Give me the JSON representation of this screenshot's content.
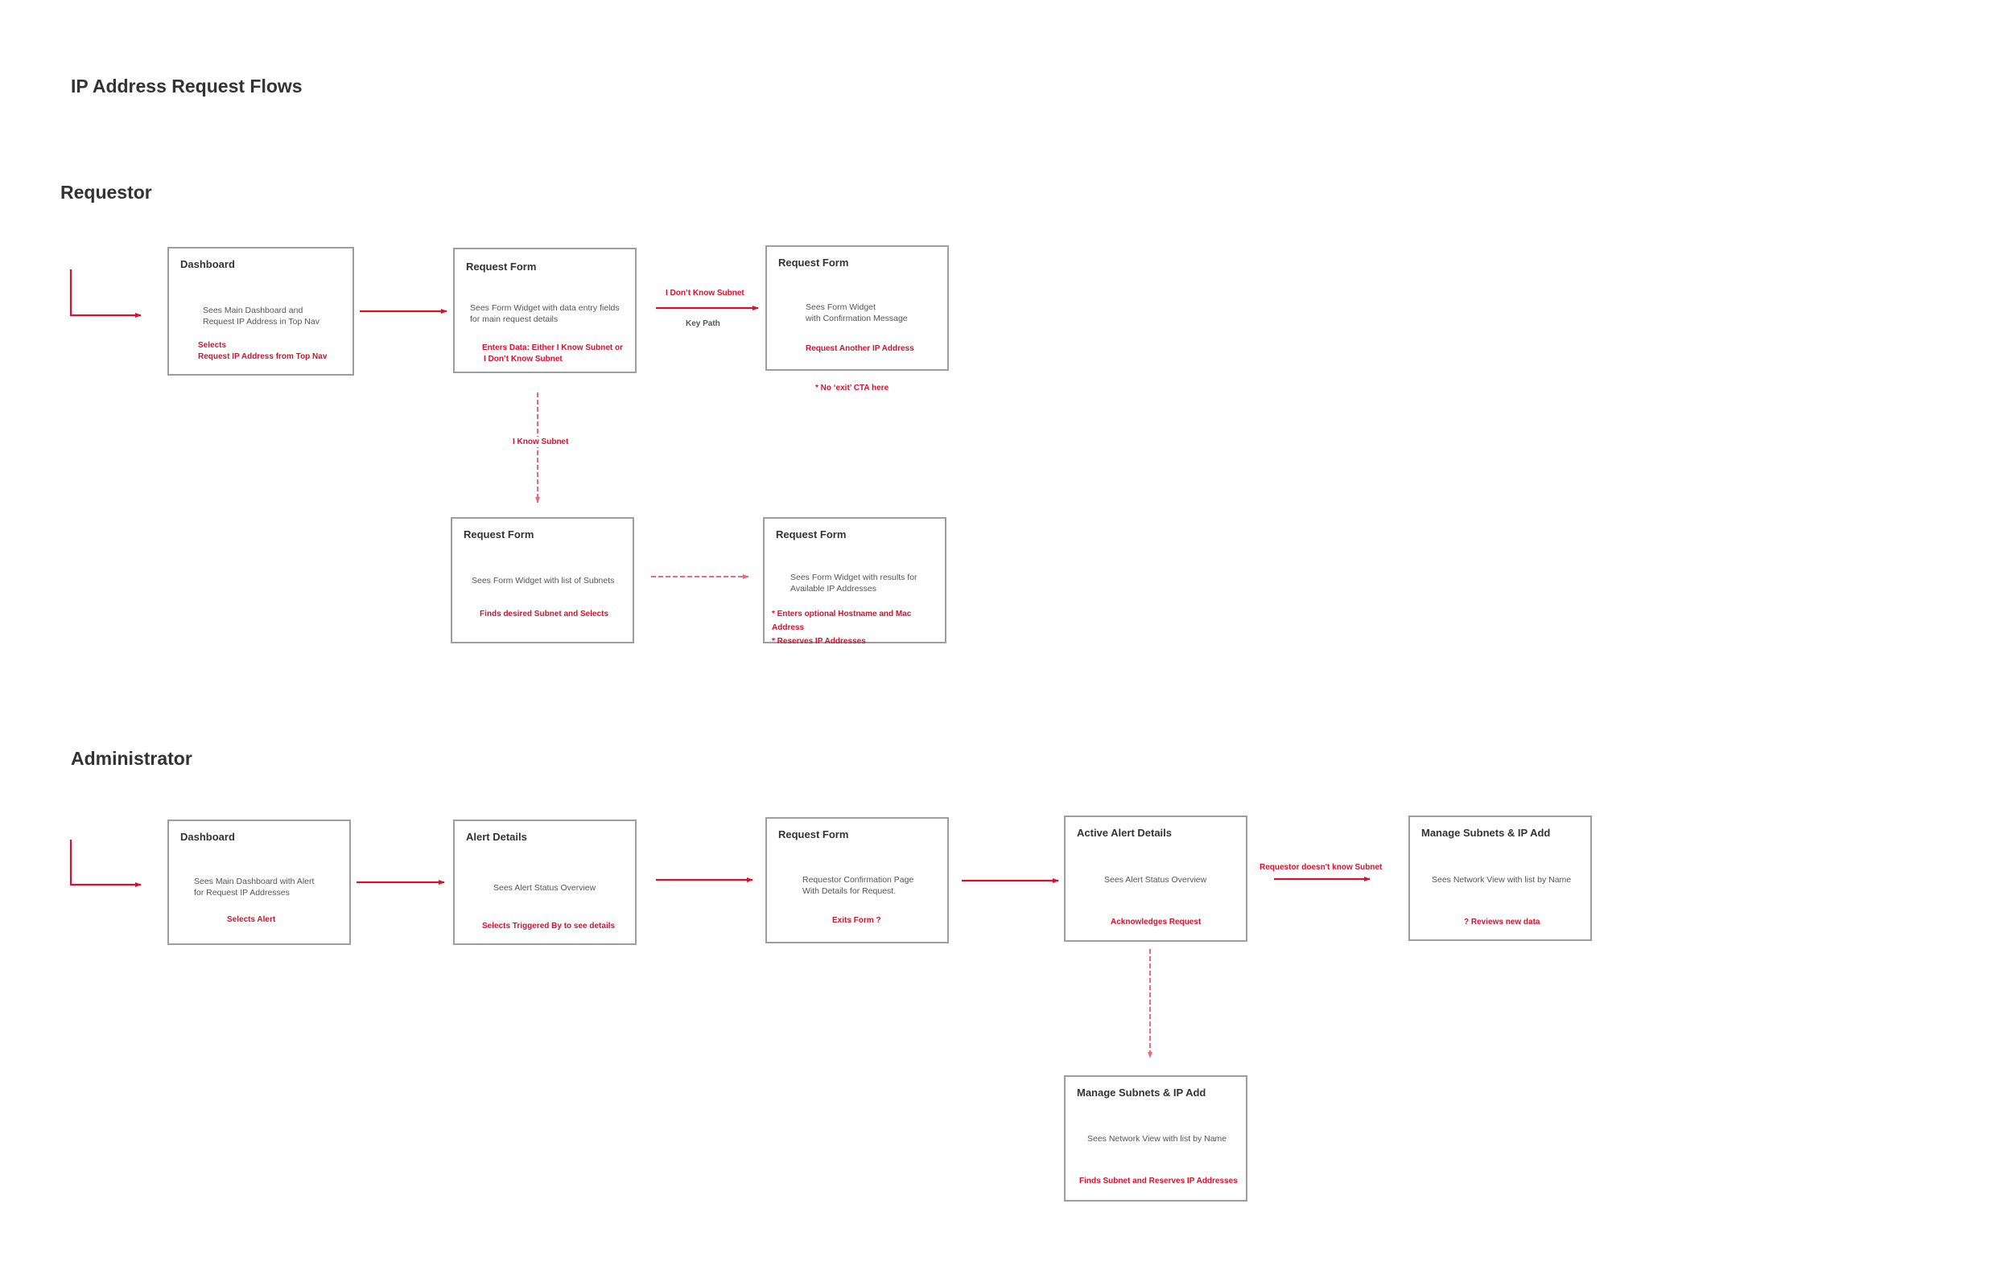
{
  "title": "IP Address Request Flows",
  "colors": {
    "accent": "#d6112f",
    "box_border": "#9e9e9e",
    "heading": "#333333",
    "body_text": "#555555"
  },
  "requestor": {
    "heading": "Requestor",
    "boxes": [
      {
        "title": "Dashboard",
        "description": "Sees Main Dashboard and\nRequest IP Address in Top Nav",
        "action": "Selects\nRequest IP Address from Top Nav"
      },
      {
        "title": "Request Form",
        "description": "Sees Form Widget with data entry fields\nfor main request details",
        "action": "Enters Data: Either I Know Subnet or\nI Don’t Know Subnet"
      },
      {
        "title": "Request Form",
        "description": "Sees Form Widget\nwith Confirmation Message",
        "action": "Request Another IP Address"
      },
      {
        "title": "Request Form",
        "description": "Sees Form Widget with list of Subnets",
        "action": "Finds desired Subnet and Selects"
      },
      {
        "title": "Request Form",
        "description": "Sees Form Widget with results for\nAvailable IP Addresses",
        "action": "* Enters optional Hostname and Mac Address\n* Reserves IP Addresses"
      }
    ],
    "connectors": {
      "dont_know_label": "I Don’t Know Subnet",
      "key_path_label": "Key Path",
      "know_label": "I Know Subnet",
      "note": "* No ‘exit’ CTA here"
    }
  },
  "administrator": {
    "heading": "Administrator",
    "boxes": [
      {
        "title": "Dashboard",
        "description": "Sees Main Dashboard with Alert\nfor Request IP Addresses",
        "action": "Selects Alert"
      },
      {
        "title": "Alert Details",
        "description": "Sees Alert Status Overview",
        "action": "Selects Triggered By to see details"
      },
      {
        "title": "Request Form",
        "description": "Requestor Confirmation Page\nWith Details for Request.",
        "action": "Exits Form ?"
      },
      {
        "title": "Active Alert Details",
        "description": "Sees Alert Status Overview",
        "action": "Acknowledges Request"
      },
      {
        "title": "Manage Subnets & IP Add",
        "description": "Sees Network View with list by Name",
        "action": "? Reviews new data"
      },
      {
        "title": "Manage Subnets & IP Add",
        "description": "Sees Network View with list by Name",
        "action": "Finds Subnet and Reserves IP Addresses"
      }
    ],
    "connectors": {
      "doesnt_know_label": "Requestor doesn't know Subnet"
    }
  }
}
